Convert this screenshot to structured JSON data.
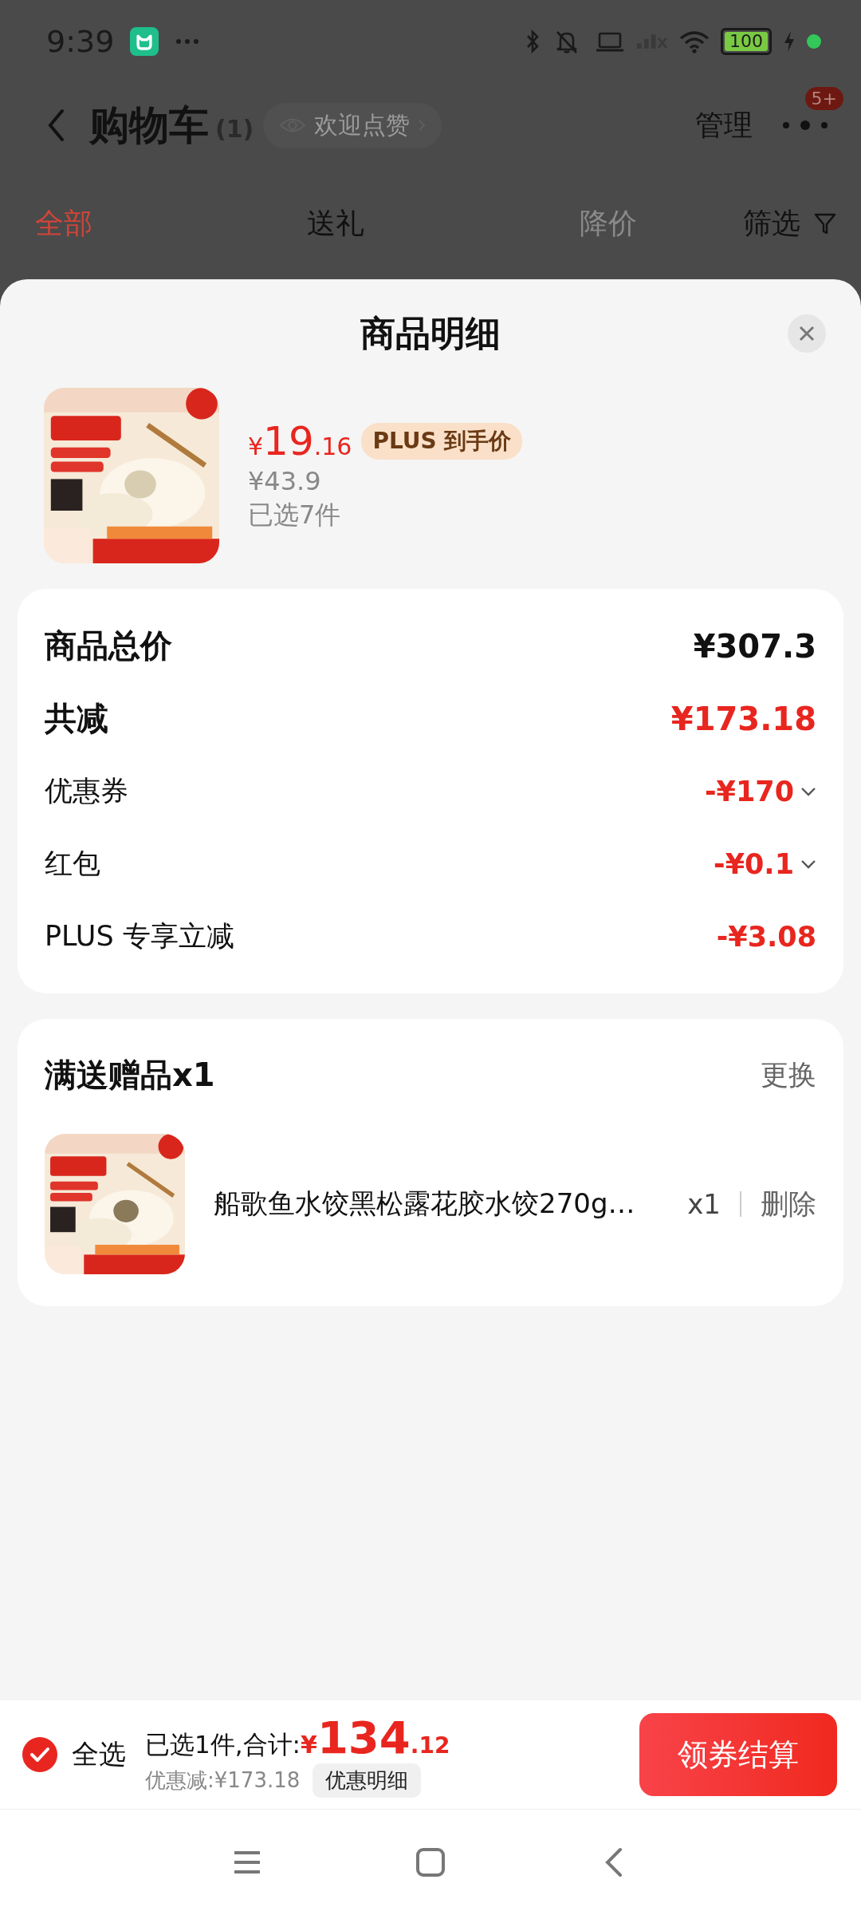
{
  "status_bar": {
    "time": "9:39",
    "battery": "100"
  },
  "header": {
    "title": "购物车",
    "count": "(1)",
    "like_pill": "欢迎点赞",
    "manage": "管理",
    "badge": "5+"
  },
  "tabs": [
    {
      "label": "全部",
      "selected": true,
      "disabled": false
    },
    {
      "label": "送礼",
      "selected": false,
      "disabled": false
    },
    {
      "label": "降价",
      "selected": false,
      "disabled": true
    }
  ],
  "filter": "筛选",
  "sheet": {
    "title": "商品明细",
    "product": {
      "price": "¥19.16",
      "plus_badge": "PLUS 到手价",
      "original_price": "¥43.9",
      "selected_count": "已选7件"
    },
    "summary_rows": [
      {
        "label": "商品总价",
        "value": "¥307.3",
        "kind": "total",
        "expandable": false
      },
      {
        "label": "共减",
        "value": "¥173.18",
        "kind": "reduction",
        "expandable": false
      },
      {
        "label": "优惠券",
        "value": "-¥170",
        "kind": "detail",
        "expandable": true
      },
      {
        "label": "红包",
        "value": "-¥0.1",
        "kind": "detail",
        "expandable": true
      },
      {
        "label": "PLUS 专享立减",
        "value": "-¥3.08",
        "kind": "detail",
        "expandable": false
      }
    ],
    "gift": {
      "title": "满送赠品x1",
      "change": "更换",
      "item": {
        "name": "船歌鱼水饺黑松露花胶水饺270g…",
        "qty": "x1",
        "delete": "删除"
      }
    }
  },
  "bottom_bar": {
    "select_all": {
      "label": "全选",
      "checked": true
    },
    "summary": "已选1件,合计:",
    "total": "¥134.12",
    "discount": "优惠减:¥173.18",
    "detail_button": "优惠明细",
    "checkout": "领券结算"
  }
}
